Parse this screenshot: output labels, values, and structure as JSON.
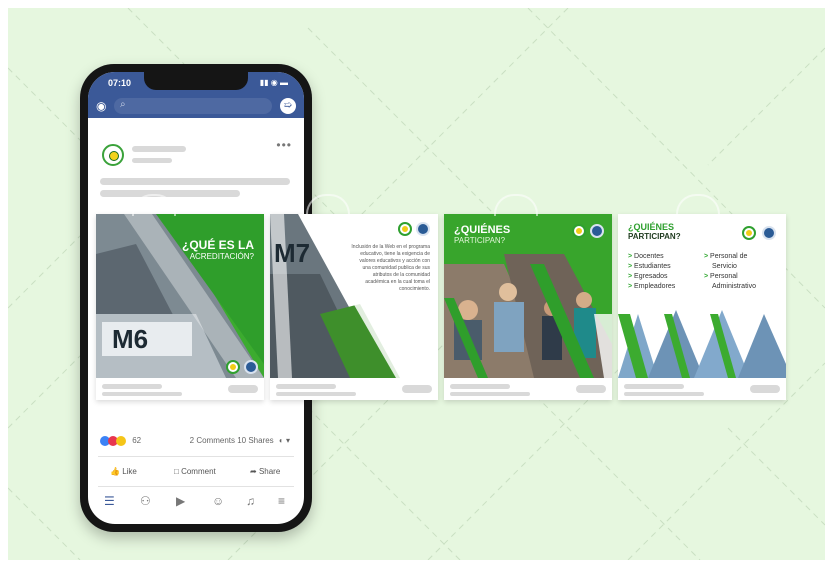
{
  "phone": {
    "status_time": "07:10",
    "status_signal": "▮▮ ◉ ▬",
    "reaction_count": "62",
    "comments_shares": "2 Comments  10 Shares",
    "share_menu": "◐ ▾",
    "actions": {
      "like": "Like",
      "comment": "Comment",
      "share": "Share"
    },
    "more": "•••",
    "icons": {
      "camera": "◉",
      "search": "⌕",
      "messenger": "➯"
    },
    "tabs": [
      "☰",
      "⚇",
      "▶",
      "☺",
      "♫",
      "≡"
    ]
  },
  "cards": [
    {
      "headline_line1": "¿QUÉ ES LA",
      "headline_line2": "ACREDITACIÓN?",
      "building_label": "M6"
    },
    {
      "building_label": "M7",
      "body_text": "Inclusión de la Web en el programa educativo, tiene la exigencia de valores educativos y acción con una comunidad publica de sus atributos de la comunidad académica en la cual toma el conocimiento."
    },
    {
      "headline_line1": "¿QUIÉNES",
      "headline_line2": "PARTICIPAN?"
    },
    {
      "headline_line1": "¿QUIÉNES",
      "headline_line2": "PARTICIPAN?",
      "list_left": [
        "Docentes",
        "Estudiantes",
        "Egresados",
        "Empleadores"
      ],
      "list_right_1": "Personal de",
      "list_right_2": "Servicio",
      "list_right_3": "Personal",
      "list_right_4": "Administrativo"
    }
  ],
  "colors": {
    "background": "#e6f7df",
    "fb_blue": "#3b5998",
    "green": "#2fa02f",
    "green_light": "#5fcf3f"
  }
}
